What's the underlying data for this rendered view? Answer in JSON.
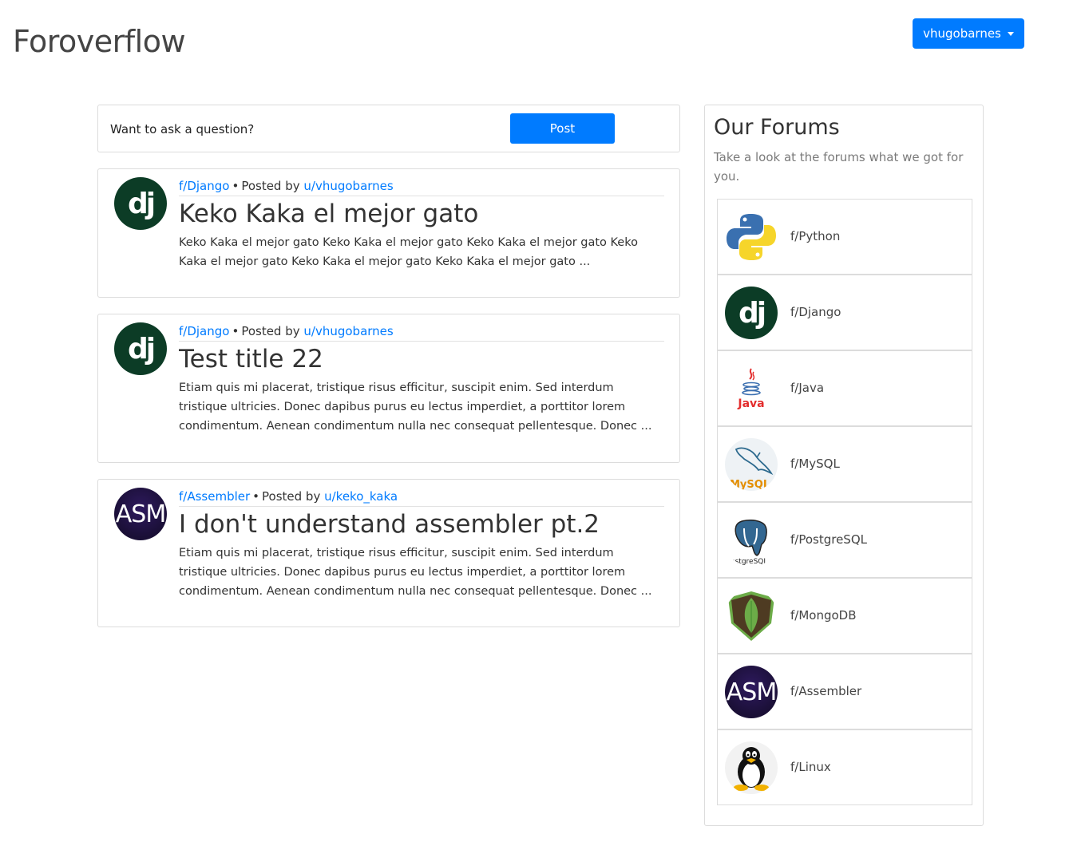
{
  "app": {
    "brand": "Foroverflow"
  },
  "user_menu": {
    "label": "vhugobarnes"
  },
  "ask": {
    "prompt": "Want to ask a question?",
    "button": "Post"
  },
  "posts": [
    {
      "forum": "f/Django",
      "posted_by_prefix": "Posted by",
      "author": "u/vhugobarnes",
      "title": "Keko Kaka el mejor gato",
      "excerpt": "Keko Kaka el mejor gato Keko Kaka el mejor gato Keko Kaka el mejor gato Keko Kaka el mejor gato Keko Kaka el mejor gato Keko Kaka el mejor gato ...",
      "icon": "django-icon"
    },
    {
      "forum": "f/Django",
      "posted_by_prefix": "Posted by",
      "author": "u/vhugobarnes",
      "title": "Test title 22",
      "excerpt": "Etiam quis mi placerat, tristique risus efficitur, suscipit enim. Sed interdum tristique ultricies. Donec dapibus purus eu lectus imperdiet, a porttitor lorem condimentum. Aenean condimentum nulla nec consequat pellentesque. Donec ...",
      "icon": "django-icon"
    },
    {
      "forum": "f/Assembler",
      "posted_by_prefix": "Posted by",
      "author": "u/keko_kaka",
      "title": "I don't understand assembler pt.2",
      "excerpt": "Etiam quis mi placerat, tristique risus efficitur, suscipit enim. Sed interdum tristique ultricies. Donec dapibus purus eu lectus imperdiet, a porttitor lorem condimentum. Aenean condimentum nulla nec consequat pellentesque. Donec ...",
      "icon": "assembler-icon"
    }
  ],
  "sidebar": {
    "title": "Our Forums",
    "subtitle": "Take a look at the forums what we got for you.",
    "forums": [
      {
        "label": "f/Python",
        "icon": "python-icon"
      },
      {
        "label": "f/Django",
        "icon": "django-icon"
      },
      {
        "label": "f/Java",
        "icon": "java-icon"
      },
      {
        "label": "f/MySQL",
        "icon": "mysql-icon"
      },
      {
        "label": "f/PostgreSQL",
        "icon": "postgresql-icon"
      },
      {
        "label": "f/MongoDB",
        "icon": "mongodb-icon"
      },
      {
        "label": "f/Assembler",
        "icon": "assembler-icon"
      },
      {
        "label": "f/Linux",
        "icon": "linux-icon"
      }
    ]
  },
  "icon_text": {
    "django": "dj",
    "asm": "ASM",
    "java": "Java",
    "mysql": "MySQL",
    "postgres": "PostgreSQL"
  },
  "colors": {
    "primary": "#007bff",
    "django": "#0c3c26",
    "border": "#dcdcdc"
  }
}
